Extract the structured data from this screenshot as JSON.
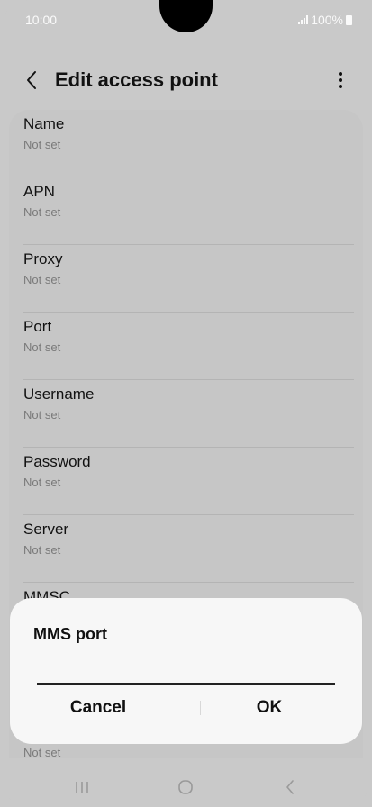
{
  "status": {
    "time": "10:00",
    "battery": "100%"
  },
  "header": {
    "title": "Edit access point"
  },
  "fields": [
    {
      "label": "Name",
      "value": "Not set"
    },
    {
      "label": "APN",
      "value": "Not set"
    },
    {
      "label": "Proxy",
      "value": "Not set"
    },
    {
      "label": "Port",
      "value": "Not set"
    },
    {
      "label": "Username",
      "value": "Not set"
    },
    {
      "label": "Password",
      "value": "Not set"
    },
    {
      "label": "Server",
      "value": "Not set"
    },
    {
      "label": "MMSC",
      "value": ""
    }
  ],
  "below_dialog_value": "Not set",
  "dialog": {
    "title": "MMS port",
    "input_value": "",
    "cancel": "Cancel",
    "ok": "OK"
  },
  "icons": {
    "back": "chevron-left-icon",
    "more": "more-vertical-icon",
    "signal": "signal-icon",
    "battery": "battery-icon",
    "nav_recents": "recents-icon",
    "nav_home": "home-icon",
    "nav_back": "nav-back-icon"
  }
}
